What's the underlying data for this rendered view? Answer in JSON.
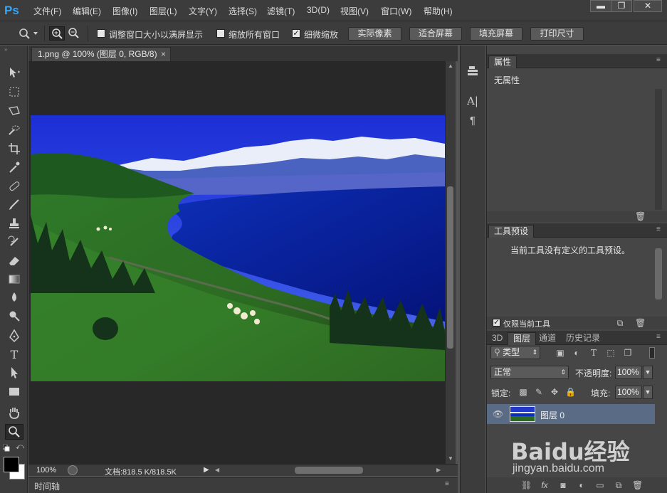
{
  "app": {
    "logo": "Ps"
  },
  "menu": [
    "文件(F)",
    "编辑(E)",
    "图像(I)",
    "图层(L)",
    "文字(Y)",
    "选择(S)",
    "滤镜(T)",
    "3D(D)",
    "视图(V)",
    "窗口(W)",
    "帮助(H)"
  ],
  "window_controls": {
    "minimize": "▬",
    "maximize": "❐",
    "close": "✕"
  },
  "options": {
    "resize_windows": "调整窗口大小以满屏显示",
    "zoom_all": "缩放所有窗口",
    "scrubby": "细微缩放",
    "btn_actual": "实际像素",
    "btn_fit": "适合屏幕",
    "btn_fill": "填充屏幕",
    "btn_print": "打印尺寸",
    "resize_checked": false,
    "zoom_all_checked": false,
    "scrubby_checked": true
  },
  "document": {
    "tab_title": "1.png @ 100% (图层 0, RGB/8)",
    "close": "×",
    "zoom": "100%",
    "doc_size": "文档:818.5 K/818.5K"
  },
  "timeline": {
    "label": "时间轴"
  },
  "properties": {
    "tab": "属性",
    "text": "无属性"
  },
  "tool_presets": {
    "tab": "工具预设",
    "text": "当前工具没有定义的工具预设。",
    "only_current": "仅限当前工具",
    "only_current_checked": true
  },
  "layers": {
    "tabs": [
      "3D",
      "图层",
      "通道",
      "历史记录"
    ],
    "active_tab": "图层",
    "filter_kind": "类型",
    "blend_mode": "正常",
    "opacity_label": "不透明度:",
    "opacity": "100%",
    "lock_label": "锁定:",
    "fill_label": "填充:",
    "fill": "100%",
    "items": [
      {
        "name": "图层 0",
        "visible": true
      }
    ]
  },
  "watermark": {
    "text": "Baidu经验",
    "url": "jingyan.baidu.com"
  },
  "colors": {
    "accent": "#31a8ff",
    "selected_layer": "#596b85",
    "bg": "#535353"
  }
}
